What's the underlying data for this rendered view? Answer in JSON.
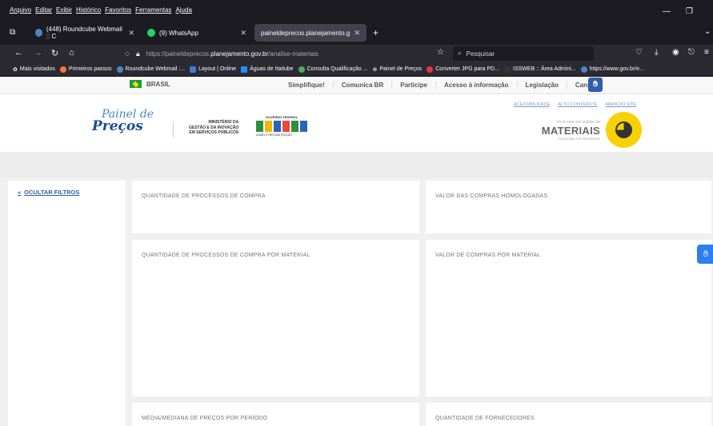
{
  "browser": {
    "menu": [
      "Arquivo",
      "Editar",
      "Exibir",
      "Histórico",
      "Favoritos",
      "Ferramentas",
      "Ajuda"
    ],
    "tabs": [
      {
        "label": "(448) Roundcube Webmail :: C",
        "active": false
      },
      {
        "label": "(9) WhatsApp",
        "active": false
      },
      {
        "label": "paineldeprecos.planejamento.gov",
        "active": true
      }
    ],
    "url_prefix": "https://paineldeprecos.",
    "url_host": "planejamento.gov.br",
    "url_path": "/analise-materiais",
    "search_placeholder": "Pesquisar",
    "bookmarks": [
      "Mais visitados",
      "Primeiros passos",
      "Roundcube Webmail :...",
      "Layout | Online",
      "Águas de Itaitube",
      "Consulta Qualificação ...",
      "Painel de Preços",
      "Converter JPG para PD...",
      "ISSWEB :: Área Admini...",
      "https://www.gov.br/e..."
    ]
  },
  "govbar": {
    "country": "BRASIL",
    "links": [
      "Simplifique!",
      "Comunica BR",
      "Participe",
      "Acesso à informação",
      "Legislação",
      "Canais"
    ]
  },
  "header": {
    "logo_line1": "Painel de",
    "logo_line2": "Preços",
    "ministry_line1": "MINISTÉRIO DA",
    "ministry_line2": "GESTÃO E DA INOVAÇÃO",
    "ministry_line3": "EM SERVIÇOS PÚBLICOS",
    "gov_federal": "GOVERNO FEDERAL",
    "gov_slogan": "UNIÃO E RECONSTRUÇÃO",
    "top_links": [
      "ACESSIBILIDADE",
      "ALTO CONTRASTE",
      "MAPA DO SITE"
    ],
    "analysis_note": "Você está em análise de",
    "section": "MATERIAIS",
    "updated": "Atualizado em 08/12/2023"
  },
  "sidebar": {
    "hide_filters": "OCULTAR FILTROS"
  },
  "cards": [
    {
      "title": "QUANTIDADE DE PROCESSOS DE COMPRA"
    },
    {
      "title": "VALOR DAS COMPRAS HOMOLOGADAS"
    },
    {
      "title": "QUANTIDADE DE PROCESSOS DE COMPRA POR MATERIAL"
    },
    {
      "title": "VALOR DE COMPRAS POR MATERIAL"
    },
    {
      "title": "MÉDIA/MEDIANA DE PREÇOS POR PERÍODO"
    },
    {
      "title": "QUANTIDADE DE FORNECEDORES"
    }
  ]
}
